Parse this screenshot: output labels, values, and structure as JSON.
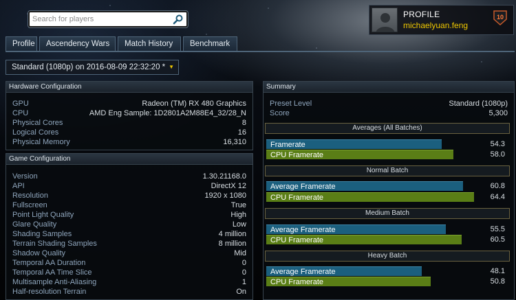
{
  "search": {
    "placeholder": "Search for players",
    "icon": "search-icon"
  },
  "profile": {
    "heading": "PROFILE",
    "username": "michaelyuan.feng",
    "rank": "10"
  },
  "tabs": [
    {
      "label": "Profile"
    },
    {
      "label": "Ascendency Wars"
    },
    {
      "label": "Match History"
    },
    {
      "label": "Benchmark"
    }
  ],
  "run_selector": {
    "value": "Standard (1080p) on 2016-08-09 22:32:20 *"
  },
  "hardware": {
    "title": "Hardware Configuration",
    "rows": [
      {
        "k": "GPU",
        "v": "Radeon (TM) RX 480 Graphics"
      },
      {
        "k": "CPU",
        "v": "AMD Eng Sample: 1D2801A2M88E4_32/28_N"
      },
      {
        "k": "Physical Cores",
        "v": "8"
      },
      {
        "k": "Logical Cores",
        "v": "16"
      },
      {
        "k": "Physical Memory",
        "v": "16,310"
      }
    ]
  },
  "game": {
    "title": "Game Configuration",
    "rows": [
      {
        "k": "Version",
        "v": "1.30.21168.0"
      },
      {
        "k": "API",
        "v": "DirectX 12"
      },
      {
        "k": "Resolution",
        "v": "1920 x 1080"
      },
      {
        "k": "Fullscreen",
        "v": "True"
      },
      {
        "k": "Point Light Quality",
        "v": "High"
      },
      {
        "k": "Glare Quality",
        "v": "Low"
      },
      {
        "k": "Shading Samples",
        "v": "4 million"
      },
      {
        "k": "Terrain Shading Samples",
        "v": "8 million"
      },
      {
        "k": "Shadow Quality",
        "v": "Mid"
      },
      {
        "k": "Temporal AA Duration",
        "v": "0"
      },
      {
        "k": "Temporal AA Time Slice",
        "v": "0"
      },
      {
        "k": "Multisample Anti-Aliasing",
        "v": "1"
      },
      {
        "k": "Half-resolution Terrain",
        "v": "On"
      }
    ]
  },
  "summary": {
    "title": "Summary",
    "rows": [
      {
        "k": "Preset Level",
        "v": "Standard (1080p)"
      },
      {
        "k": "Score",
        "v": "5,300"
      }
    ],
    "bar_scale_max": 66,
    "batches": [
      {
        "title": "Averages (All Batches)",
        "bars": [
          {
            "label": "Framerate",
            "value": 54.3,
            "display": "54.3",
            "color": "blue"
          },
          {
            "label": "CPU Framerate",
            "value": 58.0,
            "display": "58.0",
            "color": "green"
          }
        ]
      },
      {
        "title": "Normal Batch",
        "bars": [
          {
            "label": "Average Framerate",
            "value": 60.8,
            "display": "60.8",
            "color": "blue"
          },
          {
            "label": "CPU Framerate",
            "value": 64.4,
            "display": "64.4",
            "color": "green"
          }
        ]
      },
      {
        "title": "Medium Batch",
        "bars": [
          {
            "label": "Average Framerate",
            "value": 55.5,
            "display": "55.5",
            "color": "blue"
          },
          {
            "label": "CPU Framerate",
            "value": 60.5,
            "display": "60.5",
            "color": "green"
          }
        ]
      },
      {
        "title": "Heavy Batch",
        "bars": [
          {
            "label": "Average Framerate",
            "value": 48.1,
            "display": "48.1",
            "color": "blue"
          },
          {
            "label": "CPU Framerate",
            "value": 50.8,
            "display": "50.8",
            "color": "green"
          }
        ]
      }
    ]
  }
}
